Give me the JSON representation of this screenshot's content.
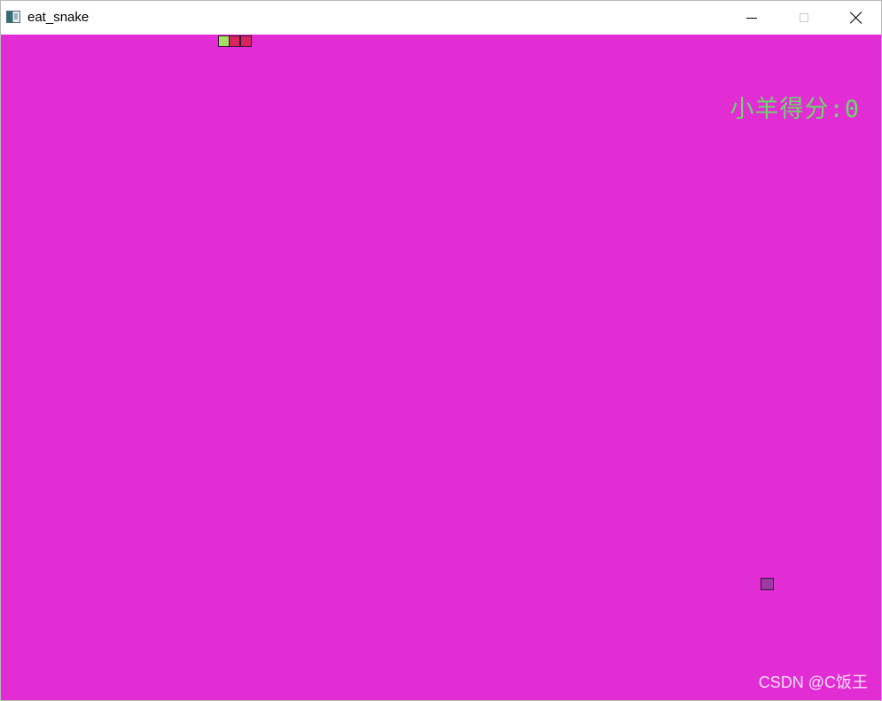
{
  "window": {
    "title": "eat_snake",
    "app_icon": "app-window-icon",
    "controls": {
      "minimize_icon": "minimize-icon",
      "maximize_icon": "maximize-icon",
      "close_icon": "close-icon"
    }
  },
  "game": {
    "background_color": "#e22cd4",
    "score_label": "小羊得分:",
    "score_value": "0",
    "score_color": "#6bd86b",
    "snake": {
      "head_color": "#a6dd63",
      "body_color": "#d8255f"
    },
    "food_color": "#9b3aa0"
  },
  "watermark": "CSDN @C饭王"
}
